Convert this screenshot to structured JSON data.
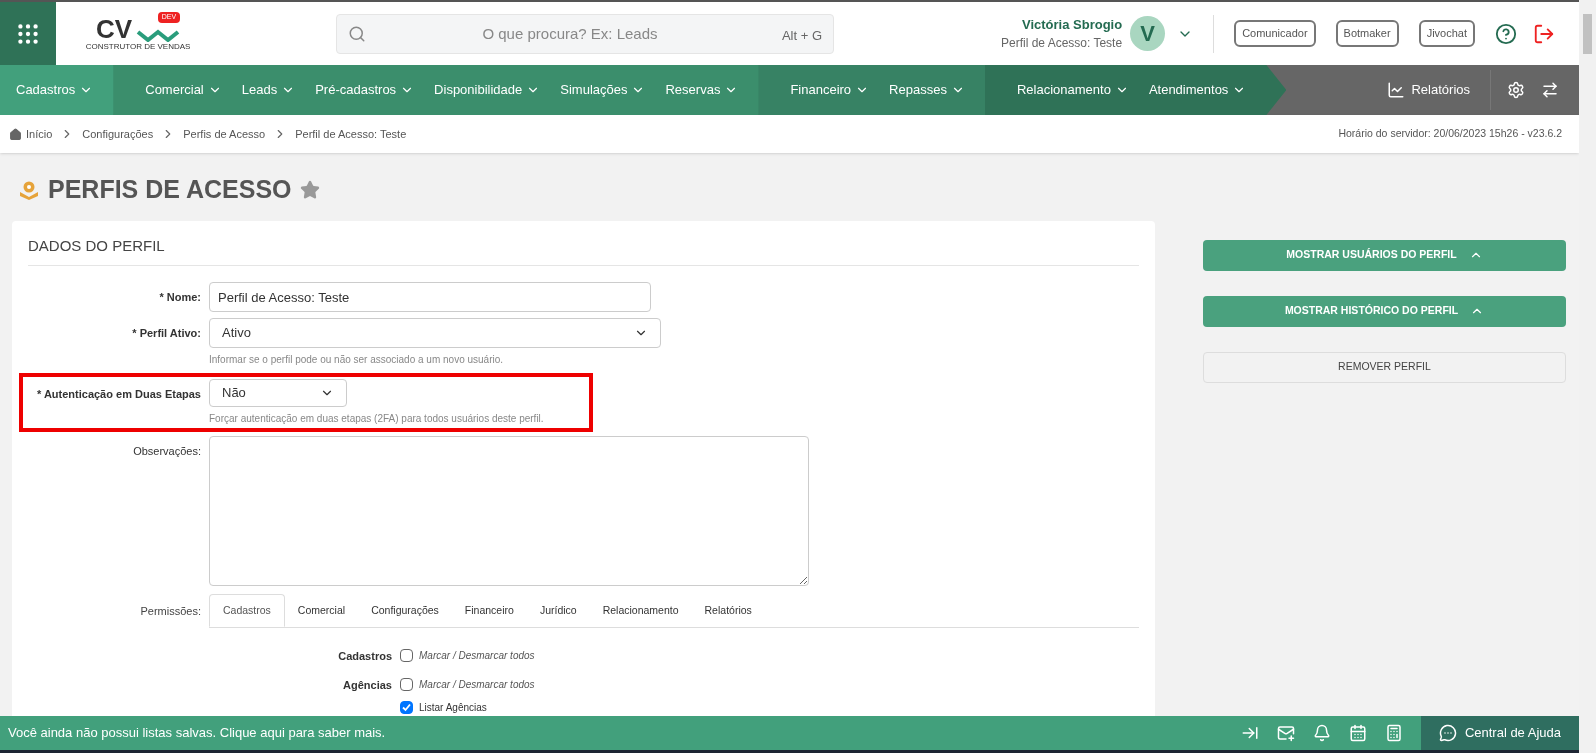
{
  "header": {
    "logo_text": "CV",
    "logo_badge": "DEV",
    "logo_caption": "CONSTRUTOR DE VENDAS",
    "search": {
      "placeholder": "O que procura? Ex: Leads",
      "shortcut": "Alt + G"
    },
    "user": {
      "name": "Victória Sbrogio",
      "profile": "Perfil de Acesso: Teste",
      "avatar": "V"
    },
    "buttons": [
      "Comunicador",
      "Botmaker",
      "Jivochat"
    ]
  },
  "nav": {
    "groups": [
      {
        "items": [
          "Cadastros"
        ]
      },
      {
        "items": [
          "Comercial",
          "Leads",
          "Pré-cadastros",
          "Disponibilidade",
          "Simulações",
          "Reservas"
        ]
      },
      {
        "items": [
          "Financeiro",
          "Repasses"
        ]
      },
      {
        "items": [
          "Relacionamento",
          "Atendimentos"
        ]
      }
    ],
    "reports": "Relatórios"
  },
  "breadcrumb": [
    "Início",
    "Configurações",
    "Perfis de Acesso",
    "Perfil de Acesso: Teste"
  ],
  "server_time": "Horário do servidor: 20/06/2023 15h26 - v23.6.2",
  "page_title": "PERFIS DE ACESSO",
  "section_title": "DADOS DO PERFIL",
  "fields": [
    {
      "kind": "input",
      "label": "* Nome:",
      "value": "Perfil de Acesso: Teste",
      "highlighted": false
    },
    {
      "kind": "select",
      "label": "* Perfil Ativo:",
      "value": "Ativo",
      "help": "Informar se o perfil pode ou não ser associado a um novo usuário.",
      "highlighted": false
    },
    {
      "kind": "select-small",
      "label": "* Autenticação em Duas Etapas",
      "value": "Não",
      "help": "Forçar autenticação em duas etapas (2FA) para todos usuários deste perfil.",
      "highlighted": true
    },
    {
      "kind": "textarea",
      "label": "Observações:",
      "highlighted": false
    }
  ],
  "permissions": {
    "label": "Permissões:",
    "tabs": [
      {
        "label": "Cadastros",
        "selected": true
      },
      {
        "label": "Comercial",
        "selected": false
      },
      {
        "label": "Configurações",
        "selected": false
      },
      {
        "label": "Financeiro",
        "selected": false
      },
      {
        "label": "Jurídico",
        "selected": false
      },
      {
        "label": "Relacionamento",
        "selected": false
      },
      {
        "label": "Relatórios",
        "selected": false
      }
    ],
    "groups": [
      {
        "title": "Cadastros",
        "toggle": "Marcar / Desmarcar todos",
        "toggle_checked": false
      },
      {
        "title": "Agências",
        "toggle": "Marcar / Desmarcar todos",
        "toggle_checked": false,
        "items": [
          {
            "label": "Listar Agências",
            "checked": true
          }
        ]
      }
    ]
  },
  "side_buttons": [
    {
      "kind": "primary",
      "label": "MOSTRAR USUÁRIOS DO PERFIL"
    },
    {
      "kind": "primary",
      "label": "MOSTRAR HISTÓRICO DO PERFIL"
    },
    {
      "kind": "secondary",
      "label": "REMOVER PERFIL"
    }
  ],
  "bottom_bar": {
    "message": "Você ainda não possui listas salvas. Clique aqui para saber mais.",
    "help": "Central de Ajuda"
  }
}
